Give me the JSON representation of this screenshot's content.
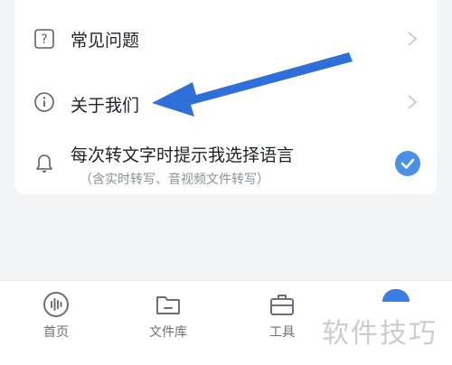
{
  "settings": {
    "items": [
      {
        "label": "常见问题",
        "icon": "question-icon"
      },
      {
        "label": "关于我们",
        "icon": "info-icon"
      },
      {
        "label": "每次转文字时提示我选择语言",
        "sublabel": "（含实时转写、音视频文件转写）",
        "icon": "bell-icon",
        "checked": true
      }
    ]
  },
  "tabbar": {
    "tabs": [
      {
        "label": "首页",
        "icon": "voice-wave-icon"
      },
      {
        "label": "文件库",
        "icon": "folder-icon"
      },
      {
        "label": "工具",
        "icon": "toolbox-icon"
      }
    ]
  },
  "watermark": "软件技巧",
  "colors": {
    "accent": "#3b7de0",
    "check": "#4a90e6",
    "arrow": "#2f6fd9"
  }
}
